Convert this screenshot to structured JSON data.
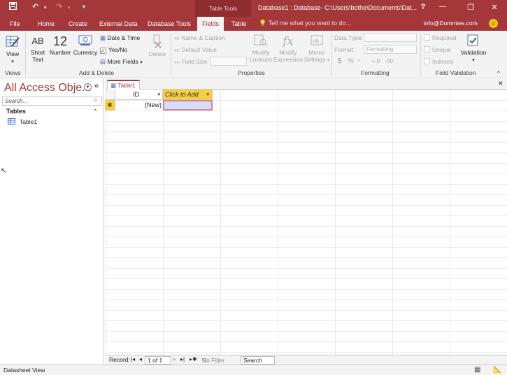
{
  "titlebar": {
    "context_group": "Table Tools",
    "window_title": "Database1 : Database- C:\\Users\\bothe\\Documents\\Dat...",
    "help": "?"
  },
  "tabs": [
    {
      "label": "File"
    },
    {
      "label": "Home"
    },
    {
      "label": "Create"
    },
    {
      "label": "External Data"
    },
    {
      "label": "Database Tools"
    },
    {
      "label": "Fields"
    },
    {
      "label": "Table"
    }
  ],
  "tell_me": "Tell me what you want to do...",
  "user_email": "info@Dummies.com",
  "ribbon": {
    "views": {
      "view_label": "View",
      "group": "Views"
    },
    "add_delete": {
      "short_text_line1": "Short",
      "short_text_line2": "Text",
      "short_text_icon": "AB",
      "number_label": "Number",
      "number_icon": "12",
      "currency_label": "Currency",
      "date_time": "Date & Time",
      "yes_no": "Yes/No",
      "more_fields": "More Fields",
      "delete": "Delete",
      "group": "Add & Delete"
    },
    "properties": {
      "name_caption": "Name & Caption",
      "default_value": "Default Value",
      "field_size": "Field Size",
      "modify_lookups_1": "Modify",
      "modify_lookups_2": "Lookups",
      "modify_expr_1": "Modify",
      "modify_expr_2": "Expression",
      "memo_1": "Memo",
      "memo_2": "Settings",
      "group": "Properties"
    },
    "formatting": {
      "data_type": "Data Type:",
      "format": "Format:",
      "format_value": "Formatting",
      "dollar": "$",
      "percent": "%",
      "group": "Formatting"
    },
    "validation": {
      "required": "Required",
      "unique": "Unique",
      "indexed": "Indexed",
      "validation": "Validation",
      "group": "Field Validation"
    }
  },
  "nav": {
    "title": "All Access Obje...",
    "search_placeholder": "Search...",
    "section": "Tables",
    "items": [
      {
        "label": "Table1"
      }
    ]
  },
  "doc_tab": "Table1",
  "sheet": {
    "col_id": "ID",
    "col_add": "Click to Add",
    "new_row": "(New)"
  },
  "record_nav": {
    "label": "Record:",
    "position": "1 of 1",
    "no_filter": "No Filter",
    "search": "Search"
  },
  "status": "Datasheet View",
  "colors": {
    "accent": "#a4373a",
    "highlight": "#f5cf3f"
  }
}
